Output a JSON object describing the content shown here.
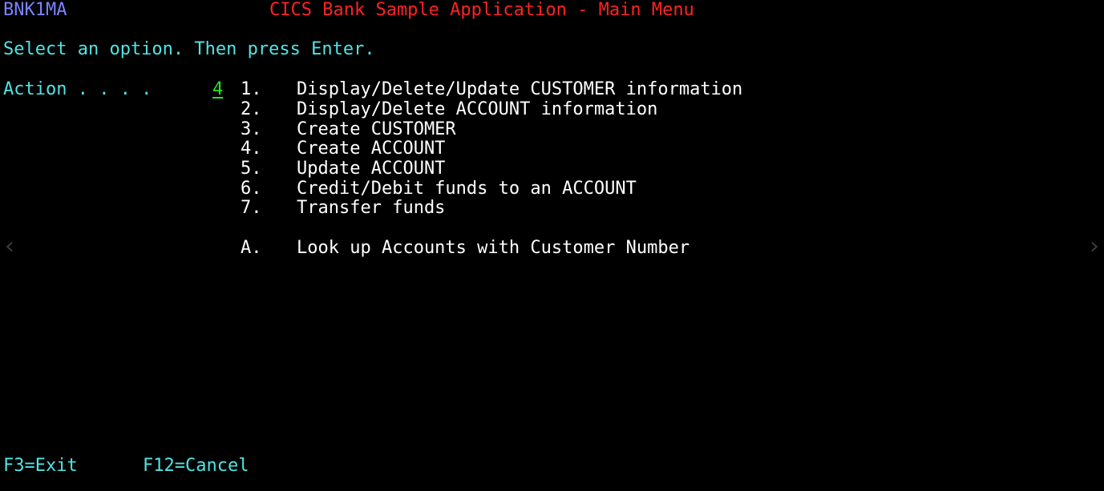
{
  "screen": {
    "map_id": "BNK1MA",
    "title": "CICS Bank Sample Application - Main Menu",
    "instruction": "Select an option. Then press Enter.",
    "action_label": "Action . . . .",
    "action_value": "4"
  },
  "menu": {
    "items": [
      {
        "key": "1.",
        "label": "Display/Delete/Update CUSTOMER information"
      },
      {
        "key": "2.",
        "label": "Display/Delete ACCOUNT information"
      },
      {
        "key": "3.",
        "label": "Create CUSTOMER"
      },
      {
        "key": "4.",
        "label": "Create ACCOUNT"
      },
      {
        "key": "5.",
        "label": "Update ACCOUNT"
      },
      {
        "key": "6.",
        "label": "Credit/Debit funds to an ACCOUNT"
      },
      {
        "key": "7.",
        "label": "Transfer funds"
      },
      {
        "key": "A.",
        "label": "Look up Accounts with Customer Number"
      }
    ]
  },
  "footer": {
    "f3": "F3=Exit",
    "f12": "F12=Cancel"
  },
  "nav": {
    "prev_icon": "chevron-left-icon",
    "next_icon": "chevron-right-icon",
    "prev_glyph": "‹",
    "next_glyph": "›"
  },
  "colors": {
    "background": "#000000",
    "map_id": "#7a84ff",
    "title": "#ff2222",
    "instruction": "#50e4e4",
    "menu_text": "#ffffff",
    "input": "#22e822"
  }
}
